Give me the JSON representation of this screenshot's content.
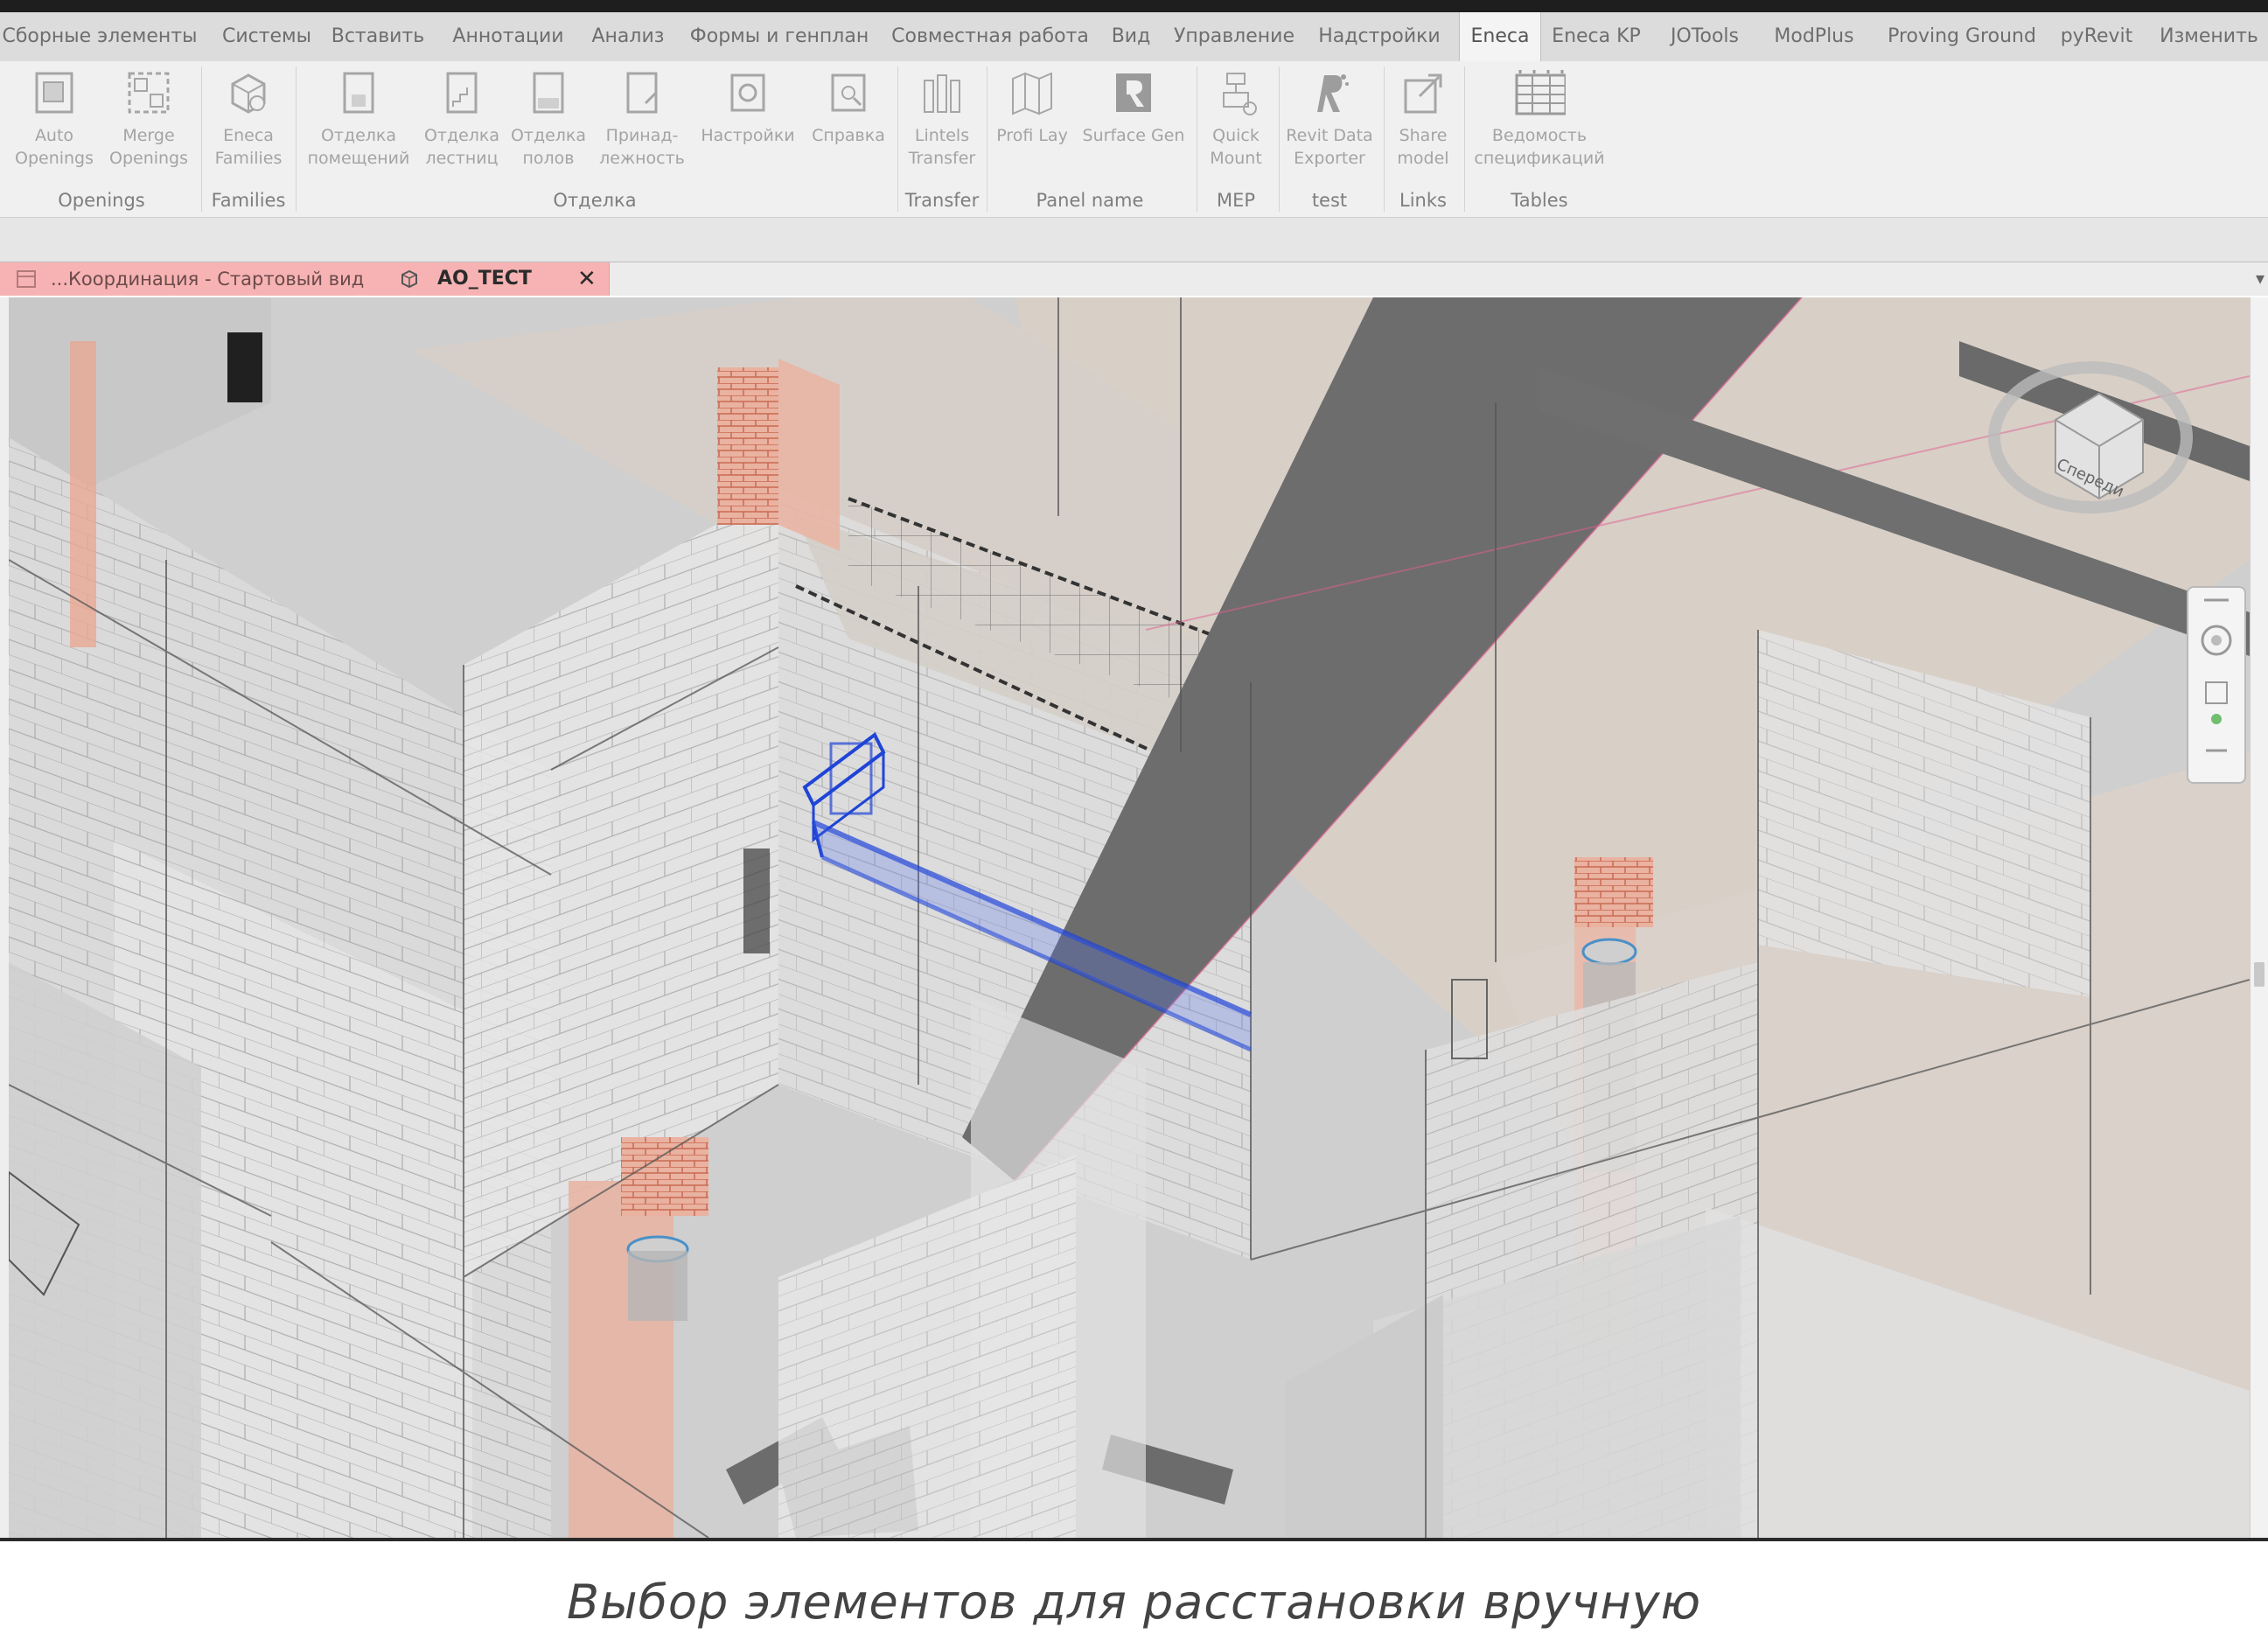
{
  "menu": {
    "tabs": [
      {
        "label": "Сборные элементы"
      },
      {
        "label": "Системы"
      },
      {
        "label": "Вставить"
      },
      {
        "label": "Аннотации"
      },
      {
        "label": "Анализ"
      },
      {
        "label": "Формы и генплан"
      },
      {
        "label": "Совместная работа"
      },
      {
        "label": "Вид"
      },
      {
        "label": "Управление"
      },
      {
        "label": "Надстройки"
      },
      {
        "label": "Eneca"
      },
      {
        "label": "Eneca KP"
      },
      {
        "label": "JOTools"
      },
      {
        "label": "ModPlus"
      },
      {
        "label": "Proving Ground"
      },
      {
        "label": "pyRevit"
      },
      {
        "label": "Изменить"
      }
    ],
    "active_tab": "Eneca"
  },
  "ribbon": {
    "buttons": [
      {
        "line1": "Auto",
        "line2": "Openings",
        "icon": "auto-openings-icon"
      },
      {
        "line1": "Merge",
        "line2": "Openings",
        "icon": "merge-openings-icon"
      },
      {
        "line1": "Eneca",
        "line2": "Families",
        "icon": "eneca-families-icon"
      },
      {
        "line1": "Отделка",
        "line2": "помещений",
        "icon": "room-finish-icon"
      },
      {
        "line1": "Отделка",
        "line2": "лестниц",
        "icon": "stair-finish-icon"
      },
      {
        "line1": "Отделка",
        "line2": "полов",
        "icon": "floor-finish-icon"
      },
      {
        "line1": "Принад-",
        "line2": "лежность",
        "icon": "ownership-icon"
      },
      {
        "line1": "Настройки",
        "line2": "",
        "icon": "settings-icon"
      },
      {
        "line1": "Справка",
        "line2": "",
        "icon": "help-icon"
      },
      {
        "line1": "Lintels",
        "line2": "Transfer",
        "icon": "lintels-transfer-icon"
      },
      {
        "line1": "Profi Lay",
        "line2": "",
        "icon": "profi-lay-icon"
      },
      {
        "line1": "Surface Gen",
        "line2": "",
        "icon": "surface-gen-icon"
      },
      {
        "line1": "Quick",
        "line2": "Mount",
        "icon": "quick-mount-icon"
      },
      {
        "line1": "Revit Data",
        "line2": "Exporter",
        "icon": "revit-data-exporter-icon"
      },
      {
        "line1": "Share",
        "line2": "model",
        "icon": "share-model-icon"
      },
      {
        "line1": "Ведомость",
        "line2": "спецификаций",
        "icon": "spec-table-icon"
      }
    ],
    "groups": [
      {
        "label": "Openings"
      },
      {
        "label": "Families"
      },
      {
        "label": "Отделка"
      },
      {
        "label": "Transfer"
      },
      {
        "label": "Panel name"
      },
      {
        "label": "MEP"
      },
      {
        "label": "test"
      },
      {
        "label": "Links"
      },
      {
        "label": "Tables"
      }
    ]
  },
  "view_tab": {
    "title": "...Координация - Стартовый вид",
    "active_view": "АО_ТЕСТ",
    "close_glyph": "✕",
    "color": "#f7b3b3"
  },
  "viewcube": {
    "face_label": "Спереди"
  },
  "caption": "Выбор элементов для расстановки вручную",
  "colors": {
    "ribbon_bg": "#f0f0f0",
    "menu_bg": "#dcdcdc",
    "brick": "#e9a590",
    "selection_blue": "#1f45d6",
    "beam_dark": "#6d6d6d",
    "view_bg": "#d2d2d2"
  }
}
